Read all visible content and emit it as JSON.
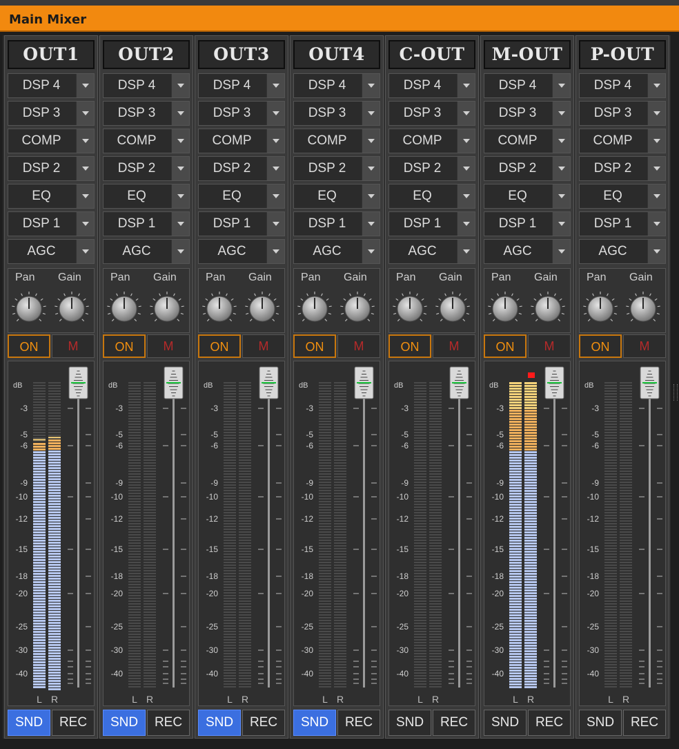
{
  "window": {
    "title": "Main Mixer"
  },
  "colors": {
    "title_bar": "#f2890f",
    "on_button": "#f2900f",
    "mute_button": "#b52a2a",
    "snd_active": "#3b6fe0",
    "meter_blue": "#b6c7ef",
    "meter_orange": "#f0b05c",
    "meter_yellow": "#f4d27a",
    "clip_red": "#ff1a1a",
    "fader_mark": "#18c23a"
  },
  "knob_labels": {
    "pan": "Pan",
    "gain": "Gain"
  },
  "meter": {
    "db_label": "dB",
    "channel_labels": {
      "left": "L",
      "right": "R"
    },
    "scale": [
      "-3",
      "-5",
      "-6",
      "-9",
      "-10",
      "-12",
      "-15",
      "-18",
      "-20",
      "-25",
      "-30",
      "-40"
    ]
  },
  "strips": [
    {
      "name": "OUT1",
      "slots": [
        "DSP 4",
        "DSP 3",
        "COMP",
        "DSP 2",
        "EQ",
        "DSP 1",
        "AGC"
      ],
      "on_label": "ON",
      "mute_label": "M",
      "snd_label": "SND",
      "rec_label": "REC",
      "snd_active": true,
      "level": {
        "left": -5.7,
        "right": -5.4,
        "peak_left": -5.4,
        "peak_right": -5.2,
        "clip": false
      }
    },
    {
      "name": "OUT2",
      "slots": [
        "DSP 4",
        "DSP 3",
        "COMP",
        "DSP 2",
        "EQ",
        "DSP 1",
        "AGC"
      ],
      "on_label": "ON",
      "mute_label": "M",
      "snd_label": "SND",
      "rec_label": "REC",
      "snd_active": true,
      "level": null
    },
    {
      "name": "OUT3",
      "slots": [
        "DSP 4",
        "DSP 3",
        "COMP",
        "DSP 2",
        "EQ",
        "DSP 1",
        "AGC"
      ],
      "on_label": "ON",
      "mute_label": "M",
      "snd_label": "SND",
      "rec_label": "REC",
      "snd_active": true,
      "level": null
    },
    {
      "name": "OUT4",
      "slots": [
        "DSP 4",
        "DSP 3",
        "COMP",
        "DSP 2",
        "EQ",
        "DSP 1",
        "AGC"
      ],
      "on_label": "ON",
      "mute_label": "M",
      "snd_label": "SND",
      "rec_label": "REC",
      "snd_active": true,
      "level": null
    },
    {
      "name": "C-OUT",
      "slots": [
        "DSP 4",
        "DSP 3",
        "COMP",
        "DSP 2",
        "EQ",
        "DSP 1",
        "AGC"
      ],
      "on_label": "ON",
      "mute_label": "M",
      "snd_label": "SND",
      "rec_label": "REC",
      "snd_active": false,
      "level": null
    },
    {
      "name": "M-OUT",
      "slots": [
        "DSP 4",
        "DSP 3",
        "COMP",
        "DSP 2",
        "EQ",
        "DSP 1",
        "AGC"
      ],
      "on_label": "ON",
      "mute_label": "M",
      "snd_label": "SND",
      "rec_label": "REC",
      "snd_active": false,
      "level": {
        "left": 0,
        "right": 0,
        "peak_left": null,
        "peak_right": null,
        "clip": true
      }
    },
    {
      "name": "P-OUT",
      "slots": [
        "DSP 4",
        "DSP 3",
        "COMP",
        "DSP 2",
        "EQ",
        "DSP 1",
        "AGC"
      ],
      "on_label": "ON",
      "mute_label": "M",
      "snd_label": "SND",
      "rec_label": "REC",
      "snd_active": false,
      "level": null
    }
  ]
}
